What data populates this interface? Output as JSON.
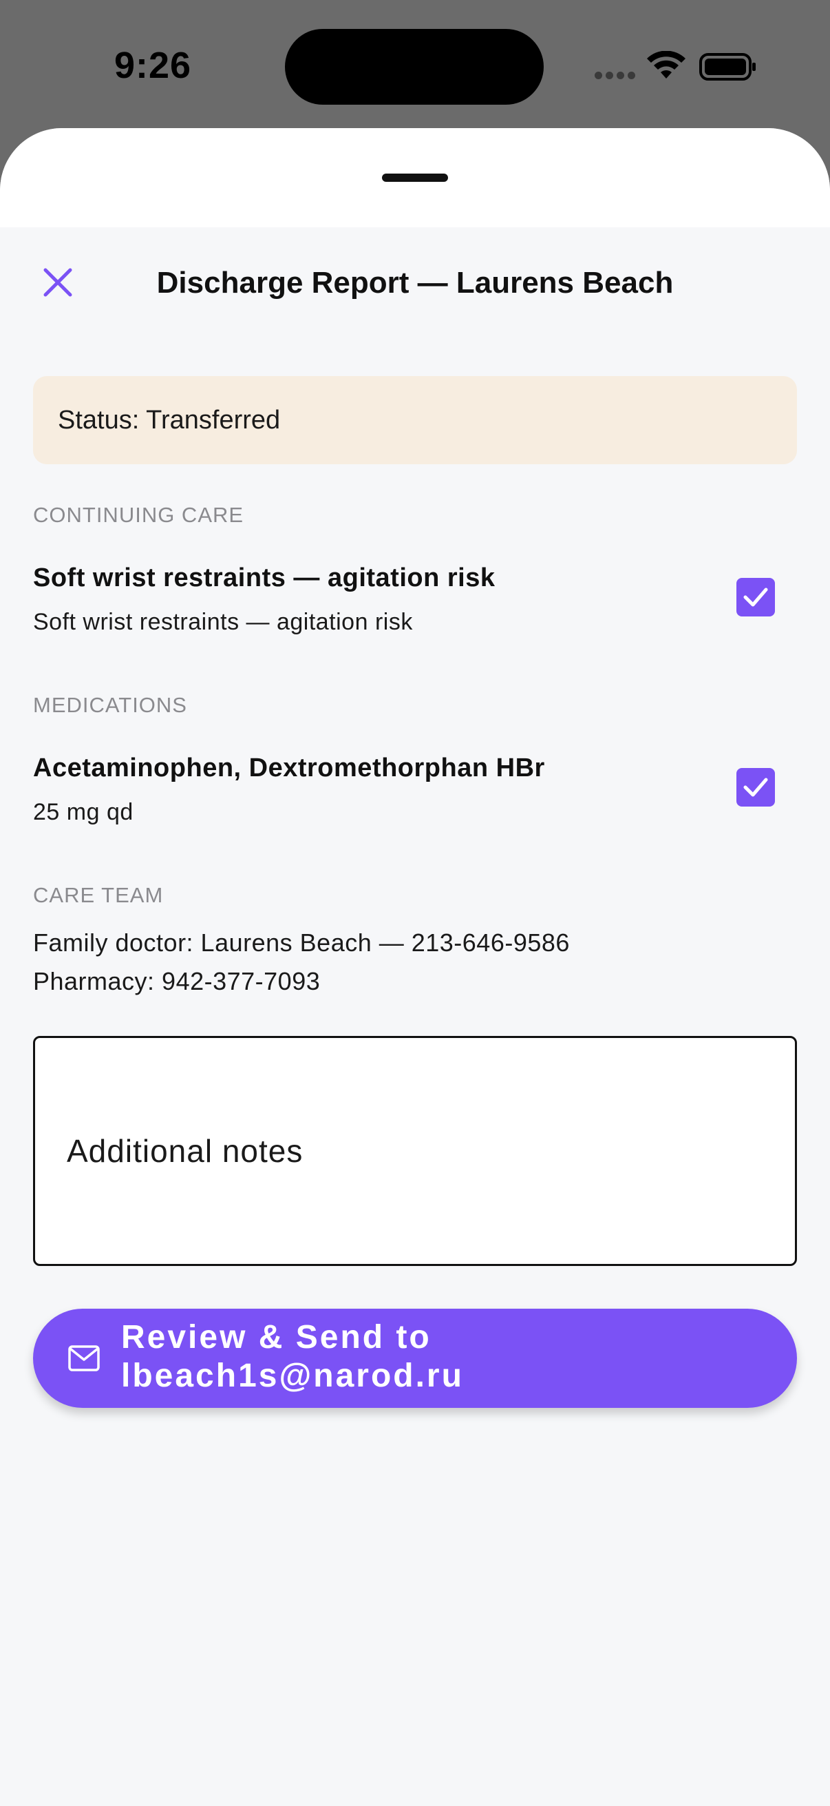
{
  "status_bar": {
    "time": "9:26"
  },
  "header": {
    "title": "Discharge Report — Laurens Beach"
  },
  "status": {
    "text": "Status: Transferred"
  },
  "sections": {
    "continuing_care": {
      "label": "CONTINUING CARE",
      "items": [
        {
          "title": "Soft wrist restraints — agitation risk",
          "subtitle": "Soft wrist restraints — agitation risk",
          "checked": true
        }
      ]
    },
    "medications": {
      "label": "MEDICATIONS",
      "items": [
        {
          "title": "Acetaminophen, Dextromethorphan HBr",
          "subtitle": "25 mg qd",
          "checked": true
        }
      ]
    },
    "care_team": {
      "label": "CARE TEAM",
      "lines": [
        "Family doctor: Laurens Beach — 213-646-9586",
        "Pharmacy: 942-377-7093"
      ]
    }
  },
  "notes": {
    "placeholder": "Additional notes"
  },
  "send_button": {
    "label_line1": "Review & Send to",
    "label_line2": "lbeach1s@narod.ru",
    "icon": "mail-icon"
  },
  "colors": {
    "accent": "#7b52f5",
    "status_bg": "#f7ede0",
    "sheet_bg": "#f6f7f9"
  }
}
